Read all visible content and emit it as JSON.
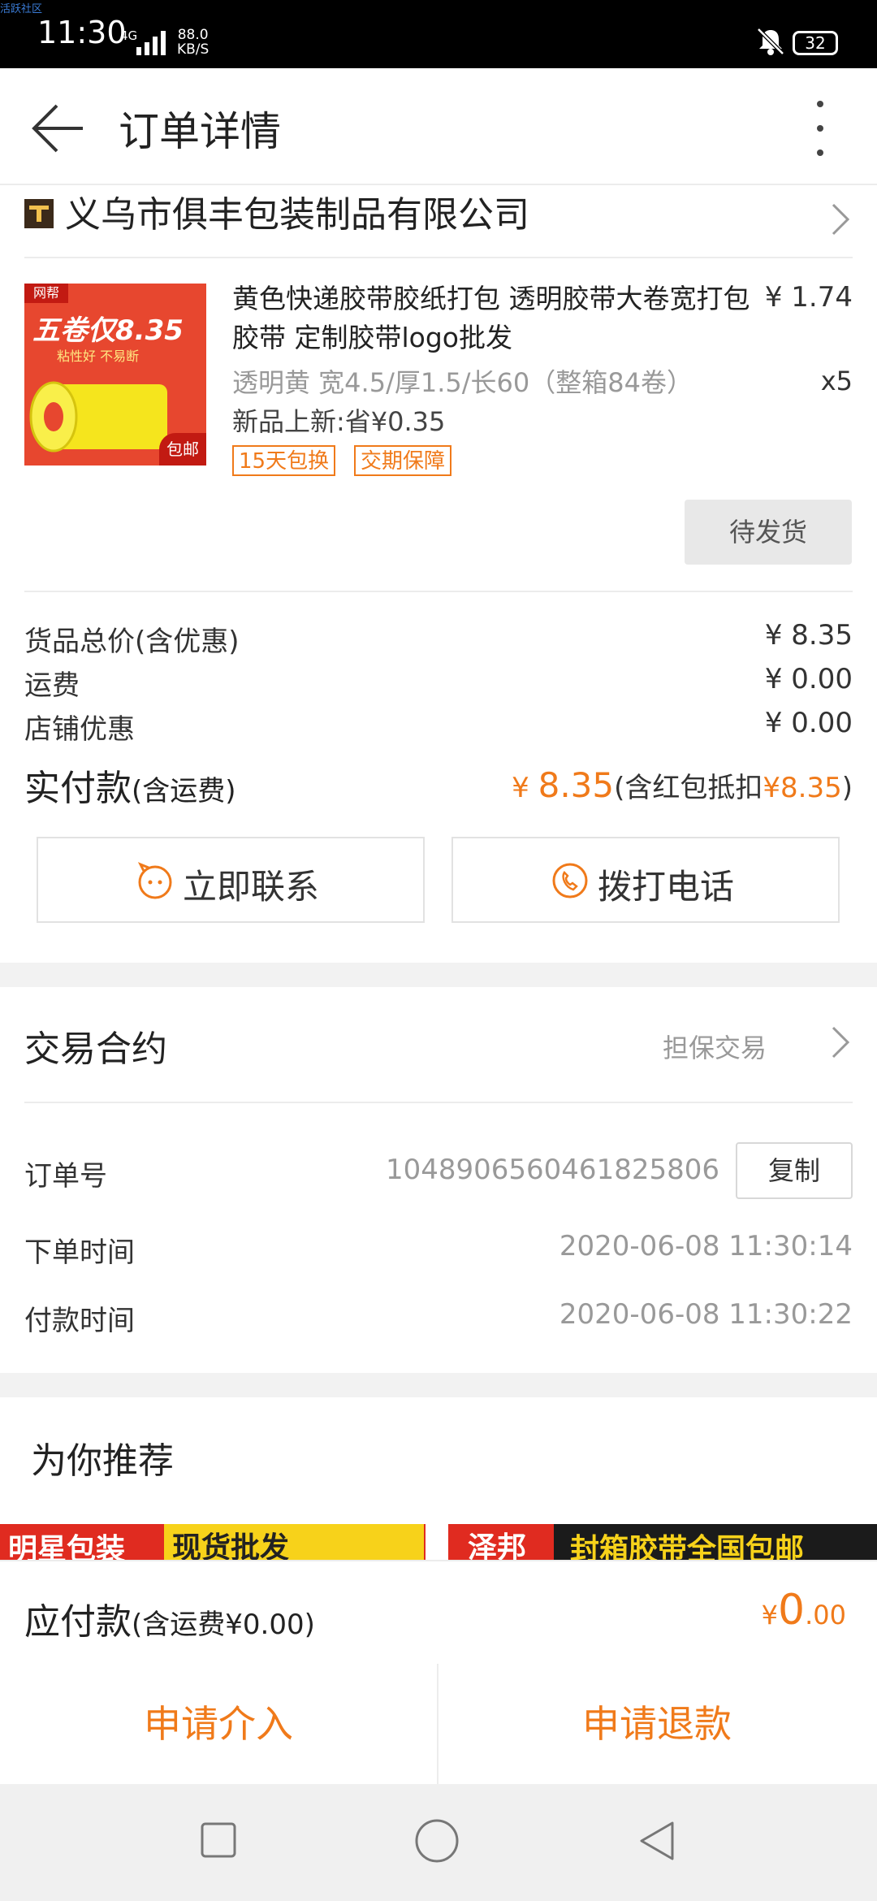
{
  "status_bar": {
    "watermark": "活跃社区",
    "time": "11:30",
    "network": "4G",
    "speed_value": "88.0",
    "speed_unit": "KB/S",
    "battery": "32"
  },
  "header": {
    "title": "订单详情",
    "back_icon": "arrow-left-icon",
    "more_icon": "more-vertical-icon"
  },
  "shop": {
    "name": "义乌市俱丰包装制品有限公司"
  },
  "product": {
    "image_badge": "网帮",
    "image_headline": "五卷仅8.35",
    "image_sub": "粘性好 不易断",
    "image_corner": "包邮",
    "title": "黄色快递胶带胶纸打包 透明胶带大卷宽打包胶带 定制胶带logo批发",
    "price": "¥ 1.74",
    "spec": "透明黄 宽4.5/厚1.5/长60（整箱84卷）",
    "quantity": "x5",
    "promo": "新品上新:省¥0.35",
    "tags": [
      "15天包换",
      "交期保障"
    ],
    "status": "待发货"
  },
  "costs": {
    "goods_total_label": "货品总价(含优惠)",
    "goods_total_value": "¥ 8.35",
    "shipping_label": "运费",
    "shipping_value": "¥ 0.00",
    "shop_discount_label": "店铺优惠",
    "shop_discount_value": "¥ 0.00",
    "paid_label": "实付款",
    "paid_label_note": "(含运费)",
    "paid_currency": "¥ ",
    "paid_amount": "8.35",
    "paid_note_prefix": "(含红包抵扣",
    "paid_note_amount": "¥8.35",
    "paid_note_suffix": ")"
  },
  "contact": {
    "chat_label": "立即联系",
    "call_label": "拨打电话"
  },
  "contract": {
    "title": "交易合约",
    "value": "担保交易"
  },
  "order_info": {
    "order_no_label": "订单号",
    "order_no": "1048906560461825806",
    "copy_label": "复制",
    "order_time_label": "下单时间",
    "order_time": "2020-06-08 11:30:14",
    "pay_time_label": "付款时间",
    "pay_time": "2020-06-08 11:30:22"
  },
  "recommend": {
    "title": "为你推荐",
    "card1_left": "明星包装",
    "card1_right": "现货批发",
    "card2_left": "泽邦",
    "card2_right": "封箱胶带全国包邮"
  },
  "payable": {
    "label": "应付款",
    "note": "(含运费¥0.00)",
    "currency": "¥",
    "integer": "0",
    "decimal": ".00"
  },
  "actions": {
    "intervene": "申请介入",
    "refund": "申请退款"
  },
  "colors": {
    "accent": "#f07a1a",
    "divider": "#ececec",
    "section_gap": "#f2f2f2"
  }
}
